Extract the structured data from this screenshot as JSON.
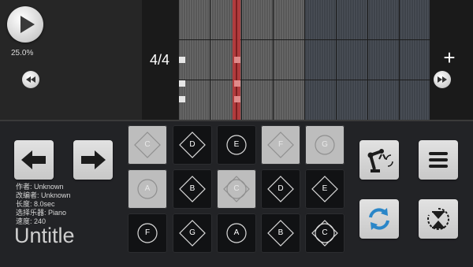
{
  "transport": {
    "play": "play-icon",
    "progress": "25.0%",
    "rewind": "rewind-icon",
    "fast_forward": "fast-forward-icon"
  },
  "timeline": {
    "time_signature": "4/4",
    "add_label": "+"
  },
  "navigation": {
    "prev": "arrow-left-icon",
    "next": "arrow-right-icon"
  },
  "song_info": {
    "author": "作者: Unknown",
    "arranger": "改编者: Unknown",
    "length": "长度: 8.0sec",
    "instrument": "选择乐器: Piano",
    "speed": "速度: 240",
    "title": "Untitle"
  },
  "pads": [
    {
      "note": "C",
      "shape": "diamond",
      "lit": true
    },
    {
      "note": "D",
      "shape": "diamond",
      "lit": false
    },
    {
      "note": "E",
      "shape": "circle",
      "lit": false
    },
    {
      "note": "F",
      "shape": "diamond",
      "lit": true
    },
    {
      "note": "G",
      "shape": "circle",
      "lit": true
    },
    {
      "note": "A",
      "shape": "circle",
      "lit": true
    },
    {
      "note": "B",
      "shape": "diamond",
      "lit": false
    },
    {
      "note": "C",
      "shape": "both",
      "lit": true
    },
    {
      "note": "D",
      "shape": "diamond",
      "lit": false
    },
    {
      "note": "E",
      "shape": "diamond",
      "lit": false
    },
    {
      "note": "F",
      "shape": "circle",
      "lit": false
    },
    {
      "note": "G",
      "shape": "diamond",
      "lit": false
    },
    {
      "note": "A",
      "shape": "circle",
      "lit": false
    },
    {
      "note": "B",
      "shape": "diamond",
      "lit": false
    },
    {
      "note": "C",
      "shape": "both",
      "lit": false
    }
  ],
  "right_controls": {
    "robot": "robot-arm-icon",
    "menu": "menu-icon",
    "sync": "sync-icon",
    "timer": "hourglass-icon"
  },
  "colors": {
    "playhead": "#b8383b",
    "pad_lit": "#bdbdbd",
    "pad_dark": "#111214",
    "sync_blue": "#2a86c8"
  }
}
